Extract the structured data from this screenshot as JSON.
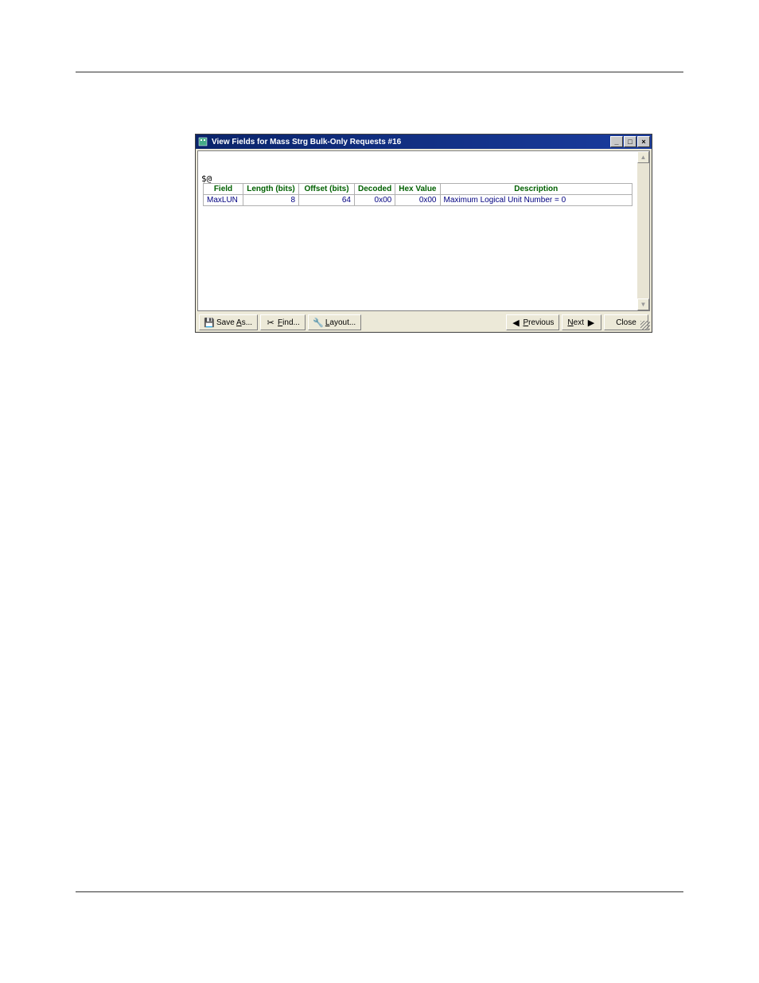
{
  "titlebar": {
    "title": "View Fields for Mass Strg Bulk-Only Requests #16"
  },
  "content": {
    "pre_label": "$@"
  },
  "table": {
    "headers": {
      "field": "Field",
      "length": "Length (bits)",
      "offset": "Offset (bits)",
      "decoded": "Decoded",
      "hex": "Hex Value",
      "description": "Description"
    },
    "rows": [
      {
        "field": "MaxLUN",
        "length": "8",
        "offset": "64",
        "decoded": "0x00",
        "hex": "0x00",
        "description": "Maximum Logical Unit Number = 0"
      }
    ]
  },
  "buttons": {
    "save_as": "Save As...",
    "find": "Find...",
    "layout": "Layout...",
    "previous": "Previous",
    "next": "Next",
    "close": "Close"
  },
  "icons": {
    "save": "💾",
    "find": "✂",
    "layout": "🔧",
    "prev_arrow": "◀",
    "next_arrow": "▶"
  }
}
